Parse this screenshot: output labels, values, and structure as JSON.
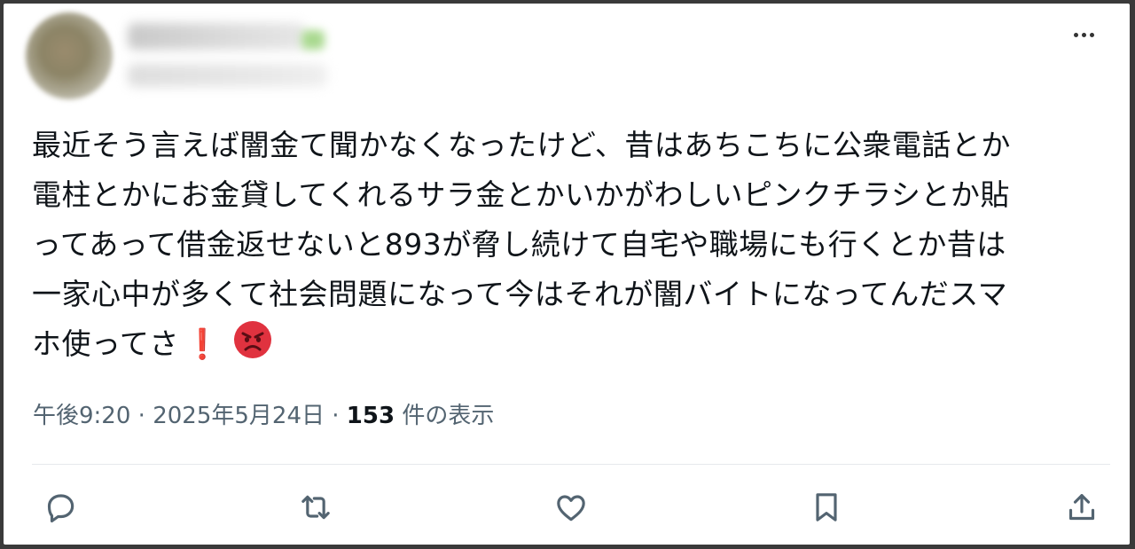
{
  "tweet": {
    "text_lines": [
      "最近そう言えば闇金て聞かなくなったけど、昔はあちこちに公衆電話とか",
      "電柱とかにお金貸してくれるサラ金とかいかがわしいピンクチラシとか貼",
      "ってあって借金返せないと893が脅し続けて自宅や職場にも行くとか昔は",
      "一家心中が多くて社会問題になって今はそれが闇バイトになってんだスマ",
      "ホ使ってさ"
    ],
    "exclamation": "❗",
    "emoji_name": "angry-face-icon"
  },
  "meta": {
    "time": "午後9:20",
    "separator": "·",
    "date": "2025年5月24日",
    "views_count": "153",
    "views_label": "件の表示"
  },
  "colors": {
    "text": "#0f1419",
    "secondary": "#536471",
    "angry_red": "#e0323f"
  }
}
